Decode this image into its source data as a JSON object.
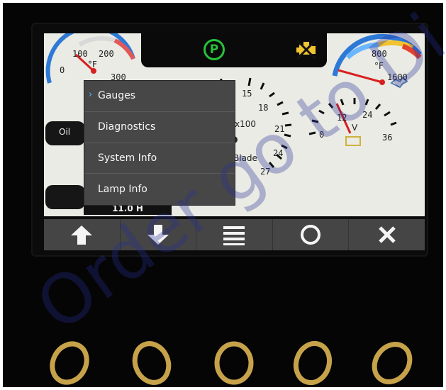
{
  "screen": {
    "left_gauge": {
      "ticks": [
        "0",
        "100",
        "200",
        "300"
      ],
      "unit": "°F"
    },
    "right_gauge": {
      "ticks": [
        "800",
        "1600"
      ],
      "unit": "°F"
    },
    "center_gauge": {
      "ticks": [
        "15",
        "18",
        "21",
        "24",
        "27"
      ],
      "multiplier": "x100",
      "label": "Blade"
    },
    "voltage_gauge": {
      "ticks": [
        "0",
        "12",
        "24",
        "36"
      ],
      "unit": "V"
    },
    "left_tab_oil": "Oil",
    "hour_meter": "11.0 H"
  },
  "menu": {
    "items": [
      {
        "label": "Gauges",
        "selected": true
      },
      {
        "label": "Diagnostics",
        "selected": false
      },
      {
        "label": "System Info",
        "selected": false
      },
      {
        "label": "Lamp Info",
        "selected": false
      }
    ]
  },
  "nav": {
    "buttons": [
      "up-arrow",
      "down-arrow",
      "menu",
      "circle",
      "close"
    ]
  },
  "colors": {
    "accent": "#61b7ff",
    "green": "#27c23a",
    "yellow": "#f0c330",
    "red": "#e0292a"
  }
}
